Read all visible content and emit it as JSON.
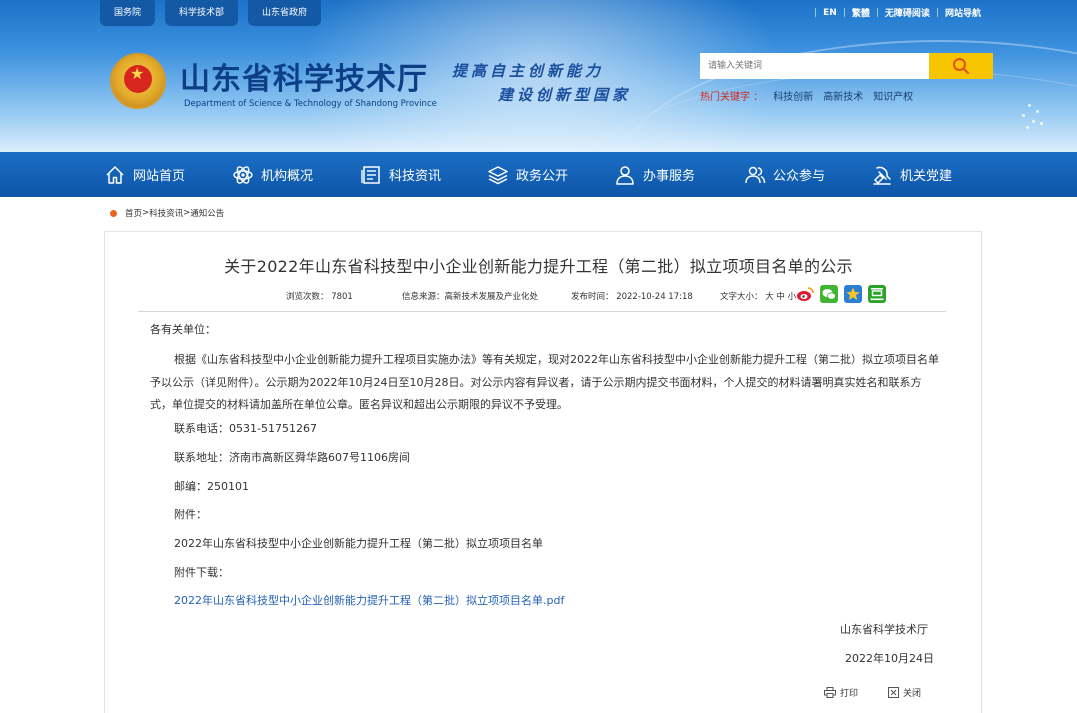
{
  "header": {
    "top_links": [
      "国务院",
      "科学技术部",
      "山东省政府"
    ],
    "right_links": [
      "EN",
      "繁體",
      "无障碍阅读",
      "网站导航"
    ],
    "site_title": "山东省科学技术厅",
    "site_subtitle": "Department of Science & Technology of Shandong Province",
    "slogan_line1": "提高自主创新能力",
    "slogan_line2": "建设创新型国家",
    "search": {
      "placeholder": "请输入关键词"
    },
    "hot_label": "热门关键字 ：",
    "hot_words": [
      "科技创新",
      "高新技术",
      "知识产权"
    ]
  },
  "nav": {
    "items": [
      {
        "label": "网站首页",
        "icon": "home-icon"
      },
      {
        "label": "机构概况",
        "icon": "atom-icon"
      },
      {
        "label": "科技资讯",
        "icon": "news-icon"
      },
      {
        "label": "政务公开",
        "icon": "layers-icon"
      },
      {
        "label": "办事服务",
        "icon": "person-icon"
      },
      {
        "label": "公众参与",
        "icon": "people-icon"
      },
      {
        "label": "机关党建",
        "icon": "party-icon"
      }
    ]
  },
  "breadcrumb": [
    "首页",
    "科技资讯",
    "通知公告"
  ],
  "article": {
    "title": "关于2022年山东省科技型中小企业创新能力提升工程（第二批）拟立项项目名单的公示",
    "meta": {
      "views": "浏览次数： 7801",
      "source": "信息来源：高新技术发展及产业化处",
      "date": "发布时间： 2022-10-24 17:18",
      "fontsize": "文字大小： 大 中 小"
    },
    "greeting": "各有关单位：",
    "paragraph": "根据《山东省科技型中小企业创新能力提升工程项目实施办法》等有关规定，现对2022年山东省科技型中小企业创新能力提升工程（第二批）拟立项项目名单予以公示（详见附件）。公示期为2022年10月24日至10月28日。对公示内容有异议者，请于公示期内提交书面材料，个人提交的材料请署明真实姓名和联系方式，单位提交的材料请加盖所在单位公章。匿名异议和超出公示期限的异议不予受理。",
    "phone": "联系电话：0531-51751267",
    "address": "联系地址：济南市高新区舜华路607号1106房间",
    "postcode": "邮编：250101",
    "attachment_label": "附件：",
    "attachment_name": "2022年山东省科技型中小企业创新能力提升工程（第二批）拟立项项目名单",
    "download_label": "附件下载：",
    "download_link": "2022年山东省科技型中小企业创新能力提升工程（第二批）拟立项项目名单.pdf",
    "signature": "山东省科学技术厅",
    "sign_date": "2022年10月24日",
    "print_label": "打印",
    "close_label": "关闭"
  }
}
